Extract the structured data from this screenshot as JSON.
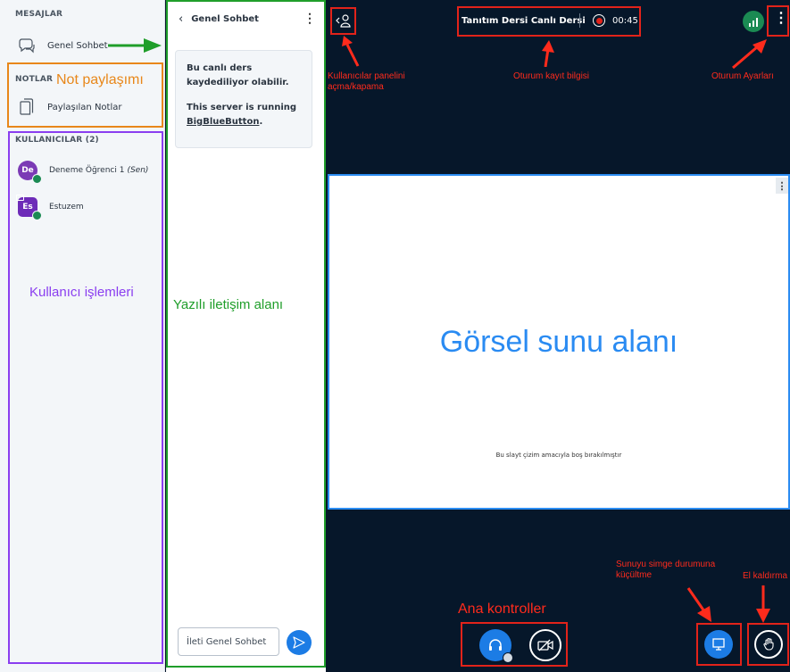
{
  "user_panel": {
    "messages_title": "MESAJLAR",
    "public_chat_label": "Genel Sohbet",
    "notes_title": "NOTLAR",
    "notes_annotation": "Not paylaşımı",
    "shared_notes_label": "Paylaşılan Notlar",
    "users_title": "KULLANICILAR (2)",
    "users": [
      {
        "initials": "De",
        "name": "Deneme Öğrenci 1",
        "suffix": "(Sen)",
        "color": "#7b3ab5"
      },
      {
        "initials": "Es",
        "name": "Estuzem",
        "suffix": "",
        "color": "#6d2bb8"
      }
    ],
    "users_annotation": "Kullanıcı işlemleri"
  },
  "chat": {
    "header_title": "Genel Sohbet",
    "welcome_line1": "Bu canlı ders",
    "welcome_line2": "kaydediliyor olabilir.",
    "welcome_line3": "This server is running",
    "welcome_link": "BigBlueButton",
    "welcome_end": ".",
    "annotation": "Yazılı iletişim alanı",
    "input_placeholder": "İleti Genel Sohbet"
  },
  "navbar": {
    "meeting_title": "Tanıtım Dersi Canlı Dersi",
    "record_time": "00:45"
  },
  "annotations": {
    "users_toggle": "Kullanıcılar panelini açma/kapama",
    "recording": "Oturum kayıt bilgisi",
    "settings": "Oturum Ayarları",
    "presentation": "Görsel sunu alanı",
    "minimize": "Sunuyu simge durumuna küçültme",
    "raise_hand": "El kaldırma",
    "main_controls": "Ana kontroller"
  },
  "presentation": {
    "slide_note": "Bu slayt çizim amacıyla boş bırakılmıştır"
  },
  "colors": {
    "primary_blue": "#1c7ce5",
    "annotation_red": "#e2231a",
    "annotation_green": "#1f9e2a",
    "annotation_orange": "#e8871a",
    "annotation_purple": "#8a3ef0",
    "dark_bg": "#06172a",
    "presentation_text_blue": "#2a8bf2"
  }
}
